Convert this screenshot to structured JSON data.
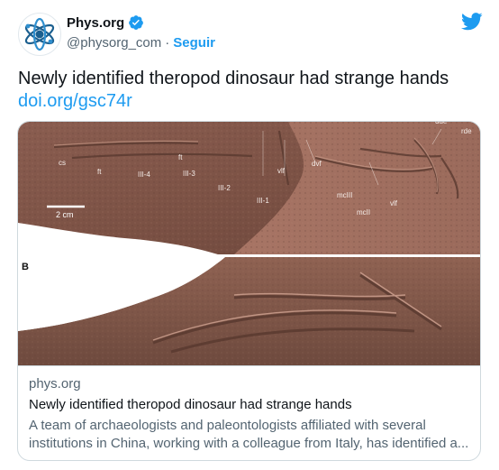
{
  "author": {
    "name": "Phys.org",
    "handle": "@physorg_com",
    "follow_label": "Seguir",
    "verified_icon": "verified-badge-icon",
    "avatar_icon": "physorg-atom-logo"
  },
  "tweet": {
    "text": "Newly identified theropod dinosaur had strange hands",
    "link": "doi.org/gsc74r"
  },
  "card": {
    "domain": "phys.org",
    "title": "Newly identified theropod dinosaur had strange hands",
    "description": "A team of archaeologists and paleontologists affiliated with several institutions in China, working with a colleague from Italy, has identified a...",
    "image": {
      "scale_label": "2 cm",
      "panel_label": "B",
      "labels": [
        "cs",
        "ft",
        "III-4",
        "ft",
        "III-3",
        "III-2",
        "III-1",
        "vlf",
        "dvf",
        "mcIII",
        "mcII",
        "vlf",
        "dde",
        "rde",
        "ft"
      ]
    }
  },
  "colors": {
    "accent": "#1d9bf0",
    "fossil_rock": "#7a5245",
    "fossil_slab": "#9a6a5b"
  }
}
